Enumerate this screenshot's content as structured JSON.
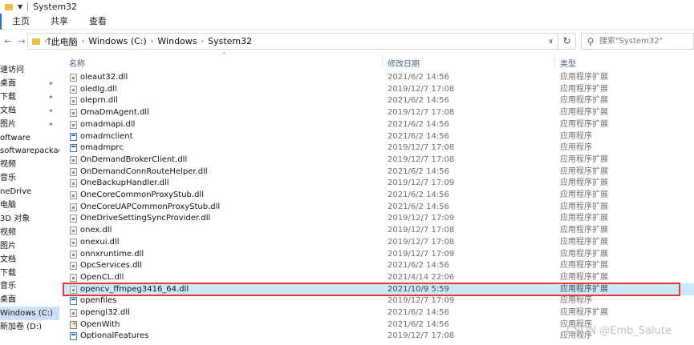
{
  "window": {
    "title": "System32"
  },
  "ribbon": {
    "tabs": [
      "主页",
      "共享",
      "查看"
    ]
  },
  "address": {
    "crumbs": [
      "此电脑",
      "Windows (C:)",
      "Windows",
      "System32"
    ]
  },
  "search": {
    "placeholder": "搜索\"System32\""
  },
  "tree": [
    {
      "label": "速访问",
      "pinned": false
    },
    {
      "label": "桌面",
      "pinned": true
    },
    {
      "label": "下载",
      "pinned": true
    },
    {
      "label": "文档",
      "pinned": true
    },
    {
      "label": "图片",
      "pinned": true
    },
    {
      "label": "oftware",
      "pinned": false
    },
    {
      "label": "softwarepackage",
      "pinned": false
    },
    {
      "label": "视频",
      "pinned": false
    },
    {
      "label": "音乐",
      "pinned": false
    },
    {
      "label": "neDrive",
      "pinned": false
    },
    {
      "label": "电脑",
      "pinned": false
    },
    {
      "label": "3D 对象",
      "pinned": false
    },
    {
      "label": "视频",
      "pinned": false
    },
    {
      "label": "图片",
      "pinned": false
    },
    {
      "label": "文档",
      "pinned": false
    },
    {
      "label": "下载",
      "pinned": false
    },
    {
      "label": "音乐",
      "pinned": false
    },
    {
      "label": "桌面",
      "pinned": false
    },
    {
      "label": "Windows (C:)",
      "pinned": false,
      "selected": true
    },
    {
      "label": "新加卷 (D:)",
      "pinned": false
    }
  ],
  "columns": {
    "name": "名称",
    "date": "修改日期",
    "type": "类型"
  },
  "files": [
    {
      "name": "oleaut32.dll",
      "date": "2021/6/2 14:56",
      "type": "应用程序扩展",
      "icon": "dll"
    },
    {
      "name": "oledlg.dll",
      "date": "2019/12/7 17:08",
      "type": "应用程序扩展",
      "icon": "dll"
    },
    {
      "name": "oleprn.dll",
      "date": "2021/6/2 14:56",
      "type": "应用程序扩展",
      "icon": "dll"
    },
    {
      "name": "OmaDmAgent.dll",
      "date": "2019/12/7 17:08",
      "type": "应用程序扩展",
      "icon": "dll"
    },
    {
      "name": "omadmapi.dll",
      "date": "2021/6/2 14:56",
      "type": "应用程序扩展",
      "icon": "dll"
    },
    {
      "name": "omadmclient",
      "date": "2021/6/2 14:56",
      "type": "应用程序",
      "icon": "exe"
    },
    {
      "name": "omadmprc",
      "date": "2019/12/7 17:08",
      "type": "应用程序",
      "icon": "exe"
    },
    {
      "name": "OnDemandBrokerClient.dll",
      "date": "2019/12/7 17:08",
      "type": "应用程序扩展",
      "icon": "dll"
    },
    {
      "name": "OnDemandConnRouteHelper.dll",
      "date": "2021/6/2 14:56",
      "type": "应用程序扩展",
      "icon": "dll"
    },
    {
      "name": "OneBackupHandler.dll",
      "date": "2019/12/7 17:09",
      "type": "应用程序扩展",
      "icon": "dll"
    },
    {
      "name": "OneCoreCommonProxyStub.dll",
      "date": "2021/6/2 14:56",
      "type": "应用程序扩展",
      "icon": "dll"
    },
    {
      "name": "OneCoreUAPCommonProxyStub.dll",
      "date": "2021/6/2 14:56",
      "type": "应用程序扩展",
      "icon": "dll"
    },
    {
      "name": "OneDriveSettingSyncProvider.dll",
      "date": "2019/12/7 17:09",
      "type": "应用程序扩展",
      "icon": "dll"
    },
    {
      "name": "onex.dll",
      "date": "2019/12/7 17:08",
      "type": "应用程序扩展",
      "icon": "dll"
    },
    {
      "name": "onexui.dll",
      "date": "2019/12/7 17:08",
      "type": "应用程序扩展",
      "icon": "dll"
    },
    {
      "name": "onnxruntime.dll",
      "date": "2019/12/7 17:09",
      "type": "应用程序扩展",
      "icon": "dll"
    },
    {
      "name": "OpcServices.dll",
      "date": "2021/6/2 14:56",
      "type": "应用程序扩展",
      "icon": "dll"
    },
    {
      "name": "OpenCL.dll",
      "date": "2021/4/14 22:06",
      "type": "应用程序扩展",
      "icon": "dll"
    },
    {
      "name": "opencv_ffmpeg3416_64.dll",
      "date": "2021/10/9 5:59",
      "type": "应用程序扩展",
      "icon": "dll",
      "selected": true
    },
    {
      "name": "openfiles",
      "date": "2019/12/7 17:09",
      "type": "应用程序",
      "icon": "exe"
    },
    {
      "name": "opengl32.dll",
      "date": "2021/6/2 14:56",
      "type": "应用程序扩展",
      "icon": "dll"
    },
    {
      "name": "OpenWith",
      "date": "2021/6/2 14:56",
      "type": "应用程序",
      "icon": "green"
    },
    {
      "name": "OptionalFeatures",
      "date": "2019/12/7 17:08",
      "type": "应用程序",
      "icon": "exe"
    }
  ],
  "watermark": "CSDN @Emb_Salute"
}
